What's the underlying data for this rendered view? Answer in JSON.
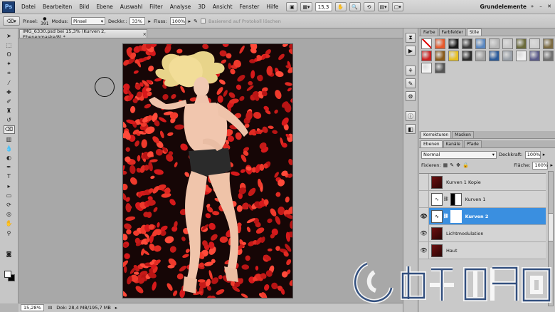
{
  "app": {
    "logo": "Ps",
    "workspace": "Grundelemente"
  },
  "menu": [
    "Datei",
    "Bearbeiten",
    "Bild",
    "Ebene",
    "Auswahl",
    "Filter",
    "Analyse",
    "3D",
    "Ansicht",
    "Fenster",
    "Hilfe"
  ],
  "menubar_controls": {
    "zoom": "15,3"
  },
  "options": {
    "brush_label": "Pinsel:",
    "brush_size": "391",
    "mode_label": "Modus:",
    "mode_value": "Pinsel",
    "opacity_label": "Deckkr.:",
    "opacity_value": "33%",
    "flow_label": "Fluss:",
    "flow_value": "100%",
    "history_label": "Basierend auf Protokoll löschen"
  },
  "document": {
    "tab_title": "IMG_6330.psd bei 15,3% (Kurven 2, Ebenenmaske/8) *",
    "close": "×"
  },
  "status": {
    "zoom": "15,28%",
    "doc": "Dok: 28,4 MB/195,7 MB"
  },
  "panels": {
    "top_tabs": [
      "Farbe",
      "Farbfelder",
      "Stile"
    ],
    "mid_tabs": [
      "Korrekturen",
      "Masken"
    ],
    "layer_tabs": [
      "Ebenen",
      "Kanäle",
      "Pfade"
    ],
    "blend_mode": "Normal",
    "opacity_label": "Deckkraft:",
    "opacity_value": "100%",
    "lock_label": "Fixieren:",
    "fill_label": "Fläche:",
    "fill_value": "100%"
  },
  "layers": [
    {
      "name": "Kurven 1 Kopie",
      "visible": false,
      "selected": false,
      "type": "image"
    },
    {
      "name": "Kurven 1",
      "visible": false,
      "selected": false,
      "type": "adjustment"
    },
    {
      "name": "Kurven 2",
      "visible": true,
      "selected": true,
      "type": "adjustment"
    },
    {
      "name": "Lichtmodulation",
      "visible": true,
      "selected": false,
      "type": "image"
    },
    {
      "name": "Haut",
      "visible": true,
      "selected": false,
      "type": "image"
    }
  ],
  "colors": {
    "selected_layer": "#3a8fe0",
    "petals": "#d6191b"
  }
}
